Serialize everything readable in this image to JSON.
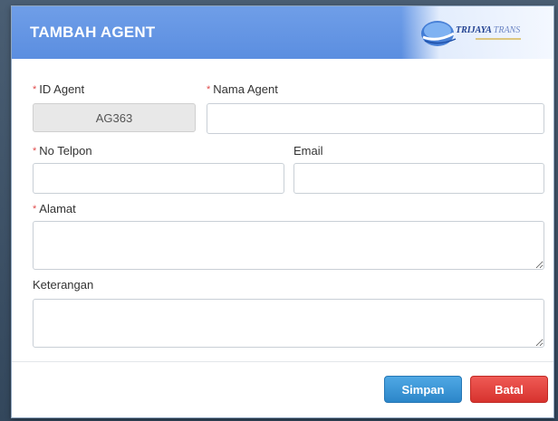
{
  "modal": {
    "title": "TAMBAH AGENT",
    "logo": {
      "name_main": "TRIJAYA",
      "name_accent": "TRANS"
    }
  },
  "form": {
    "id_agent": {
      "label": "ID Agent",
      "required_mark": "*",
      "value": "AG363"
    },
    "nama_agent": {
      "label": "Nama Agent",
      "required_mark": "*",
      "value": ""
    },
    "no_telpon": {
      "label": "No Telpon",
      "required_mark": "*",
      "value": ""
    },
    "email": {
      "label": "Email",
      "value": ""
    },
    "alamat": {
      "label": "Alamat",
      "required_mark": "*",
      "value": ""
    },
    "keterangan": {
      "label": "Keterangan",
      "value": ""
    }
  },
  "actions": {
    "save_label": "Simpan",
    "cancel_label": "Batal"
  },
  "colors": {
    "header": "#5b8ee0",
    "required": "#e04b4b",
    "save": "#2c86c9",
    "cancel": "#d7332e"
  }
}
